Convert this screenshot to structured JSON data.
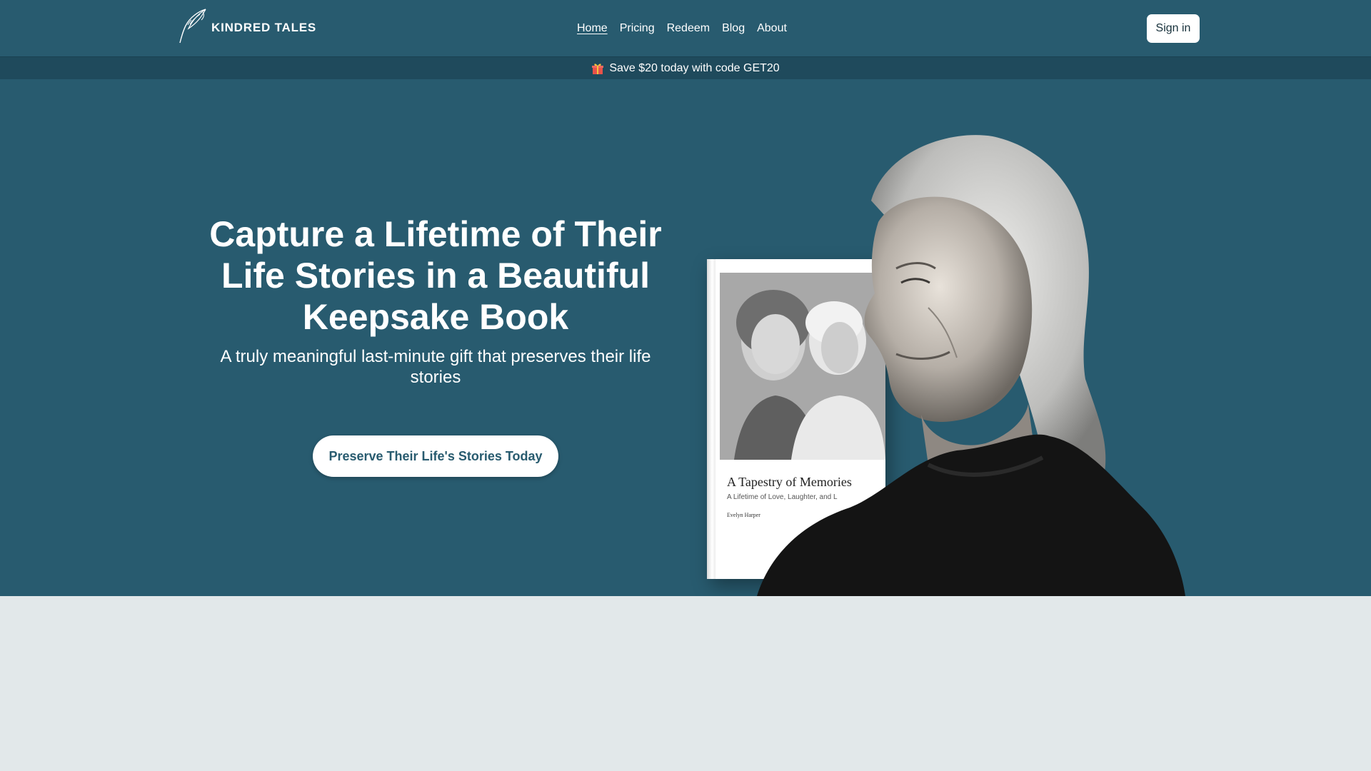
{
  "brand": {
    "name": "KINDRED TALES",
    "logo_icon": "feather-quill-icon"
  },
  "nav": {
    "items": [
      {
        "label": "Home",
        "active": true
      },
      {
        "label": "Pricing",
        "active": false
      },
      {
        "label": "Redeem",
        "active": false
      },
      {
        "label": "Blog",
        "active": false
      },
      {
        "label": "About",
        "active": false
      }
    ]
  },
  "header": {
    "signin_label": "Sign in"
  },
  "promo": {
    "icon": "gift-icon",
    "text": "Save $20 today with code GET20"
  },
  "hero": {
    "title": "Capture a Lifetime of Their Life Stories in a Beautiful Keepsake Book",
    "subtitle": "A truly meaningful last-minute gift that preserves their life stories",
    "cta_label": "Preserve Their Life's Stories Today"
  },
  "book": {
    "title": "A Tapestry of Memories",
    "subtitle": "A Lifetime of Love, Laughter, and L",
    "author": "Evelyn Harper"
  },
  "colors": {
    "primary": "#285b6f",
    "promo_bar": "#1f4a5c",
    "lower_bg": "#e2e8ea",
    "text_light": "#ffffff"
  }
}
